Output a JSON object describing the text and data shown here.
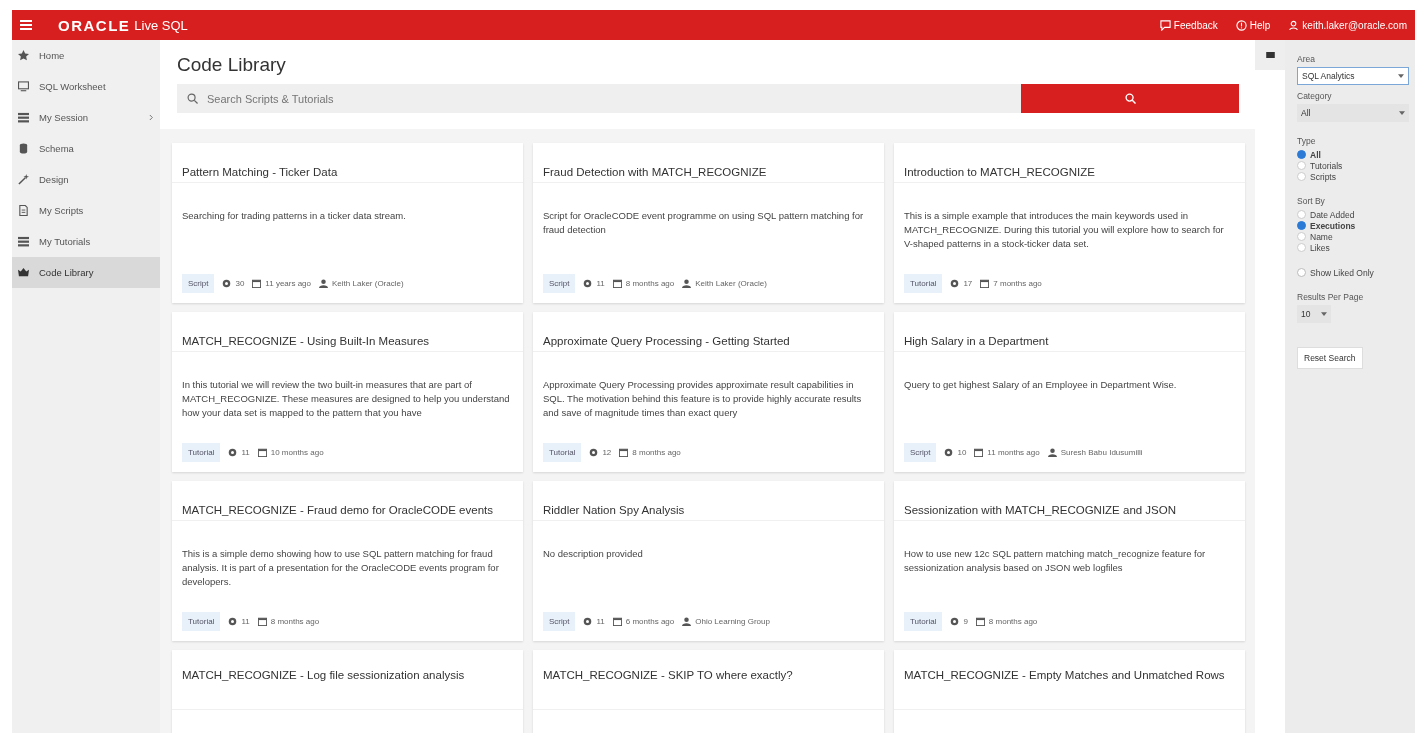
{
  "header": {
    "logo": "ORACLE",
    "product": "Live SQL",
    "links": [
      {
        "kind": "feedback",
        "label": "Feedback"
      },
      {
        "kind": "help",
        "label": "Help"
      },
      {
        "kind": "user",
        "label": "keith.laker@oracle.com"
      }
    ]
  },
  "sidebar": {
    "items": [
      {
        "kind": "home",
        "label": "Home",
        "selected": false
      },
      {
        "kind": "worksheet",
        "label": "SQL Worksheet",
        "selected": false
      },
      {
        "kind": "session",
        "label": "My Session",
        "selected": false,
        "expanded": false
      },
      {
        "kind": "schema",
        "label": "Schema",
        "selected": false
      },
      {
        "kind": "design",
        "label": "Design",
        "selected": false
      },
      {
        "kind": "scripts",
        "label": "My Scripts",
        "selected": false
      },
      {
        "kind": "tutorials",
        "label": "My Tutorials",
        "selected": false
      },
      {
        "kind": "library",
        "label": "Code Library",
        "selected": true
      }
    ]
  },
  "page": {
    "title": "Code Library",
    "search": {
      "placeholder": "Search Scripts & Tutorials"
    }
  },
  "cards": [
    {
      "title": "Pattern Matching - Ticker Data",
      "description": "Searching for trading patterns in a ticker data stream.",
      "type": "Script",
      "views": "30",
      "date": "11 years ago",
      "author": "Keith Laker (Oracle)"
    },
    {
      "title": "Fraud Detection with MATCH_RECOGNIZE",
      "description": "Script for OracleCODE event programme on using SQL pattern matching for fraud detection",
      "type": "Script",
      "views": "11",
      "date": "8 months ago",
      "author": "Keith Laker (Oracle)"
    },
    {
      "title": "Introduction to MATCH_RECOGNIZE",
      "description": "This is a simple example that introduces the main keywords used in MATCH_RECOGNIZE. During this tutorial you will explore how to search for V-shaped patterns in a stock-ticker data set.",
      "type": "Tutorial",
      "views": "17",
      "date": "7 months ago"
    },
    {
      "title": "MATCH_RECOGNIZE - Using Built-In Measures",
      "description": "In this tutorial we will review the two built-in measures that are part of MATCH_RECOGNIZE. These measures are designed to help you understand how your data set is mapped to the pattern that you have",
      "type": "Tutorial",
      "views": "11",
      "date": "10 months ago"
    },
    {
      "title": "Approximate Query Processing - Getting Started",
      "description": "Approximate Query Processing provides approximate result capabilities in SQL. The motivation behind this feature is to provide highly accurate results and save of magnitude times than exact query",
      "type": "Tutorial",
      "views": "12",
      "date": "8 months ago"
    },
    {
      "title": "High Salary in a Department",
      "description": "Query to get highest Salary of an Employee in Department Wise.",
      "type": "Script",
      "views": "10",
      "date": "11 months ago",
      "author": "Suresh Babu Idusumilli"
    },
    {
      "title": "MATCH_RECOGNIZE - Fraud demo for OracleCODE events",
      "description": "This is a simple demo showing how to use SQL pattern matching for fraud analysis. It is part of a presentation for the OracleCODE events program for developers.",
      "type": "Tutorial",
      "views": "11",
      "date": "8 months ago"
    },
    {
      "title": "Riddler Nation Spy Analysis",
      "description": "No description provided",
      "type": "Script",
      "views": "11",
      "date": "6 months ago",
      "author": "Ohio Learning Group"
    },
    {
      "title": "Sessionization with MATCH_RECOGNIZE and JSON",
      "description": "How to use new 12c SQL pattern matching match_recognize feature for sessionization analysis based on JSON web logfiles",
      "type": "Tutorial",
      "views": "9",
      "date": "8 months ago"
    },
    {
      "title": "MATCH_RECOGNIZE - Log file sessionization analysis"
    },
    {
      "title": "MATCH_RECOGNIZE - SKIP TO where exactly?"
    },
    {
      "title": "MATCH_RECOGNIZE - Empty Matches and Unmatched Rows"
    }
  ],
  "filters": {
    "area": {
      "label": "Area",
      "value": "SQL Analytics"
    },
    "category": {
      "label": "Category",
      "value": "All"
    },
    "type": {
      "label": "Type",
      "options": [
        {
          "label": "All",
          "selected": true
        },
        {
          "label": "Tutorials",
          "selected": false
        },
        {
          "label": "Scripts",
          "selected": false
        }
      ]
    },
    "sort": {
      "label": "Sort By",
      "options": [
        {
          "label": "Date Added",
          "selected": false
        },
        {
          "label": "Executions",
          "selected": true
        },
        {
          "label": "Name",
          "selected": false
        },
        {
          "label": "Likes",
          "selected": false
        }
      ]
    },
    "liked_only": {
      "label": "Show Liked Only",
      "checked": false
    },
    "per_page": {
      "label": "Results Per Page",
      "value": "10"
    },
    "reset": "Reset Search"
  }
}
